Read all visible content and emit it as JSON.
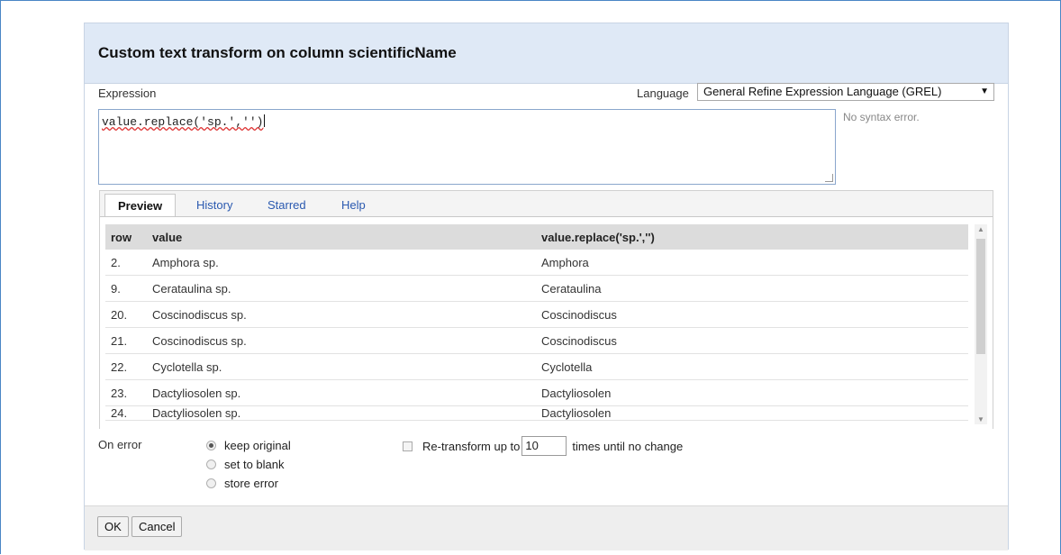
{
  "dialog": {
    "title": "Custom text transform on column scientificName"
  },
  "expression": {
    "label": "Expression",
    "value": "value.replace('sp.','')",
    "status": "No syntax error."
  },
  "language": {
    "label": "Language",
    "selected": "General Refine Expression Language (GREL)",
    "arrow": "▼"
  },
  "tabs": [
    {
      "label": "Preview"
    },
    {
      "label": "History"
    },
    {
      "label": "Starred"
    },
    {
      "label": "Help"
    }
  ],
  "preview": {
    "headers": [
      "row",
      "value",
      "value.replace('sp.','')"
    ],
    "rows": [
      [
        "2.",
        "Amphora sp.",
        "Amphora"
      ],
      [
        "9.",
        "Cerataulina sp.",
        "Cerataulina"
      ],
      [
        "20.",
        "Coscinodiscus sp.",
        "Coscinodiscus"
      ],
      [
        "21.",
        "Coscinodiscus sp.",
        "Coscinodiscus"
      ],
      [
        "22.",
        "Cyclotella sp.",
        "Cyclotella"
      ],
      [
        "23.",
        "Dactyliosolen sp.",
        "Dactyliosolen"
      ],
      [
        "24.",
        "Dactyliosolen sp.",
        "Dactyliosolen"
      ]
    ]
  },
  "on_error": {
    "label": "On error",
    "options": [
      "keep original",
      "set to blank",
      "store error"
    ],
    "selected": "keep original"
  },
  "retransform": {
    "label_before": "Re-transform up to",
    "times": "10",
    "label_after": "times until no change"
  },
  "buttons": {
    "ok": "OK",
    "cancel": "Cancel"
  }
}
